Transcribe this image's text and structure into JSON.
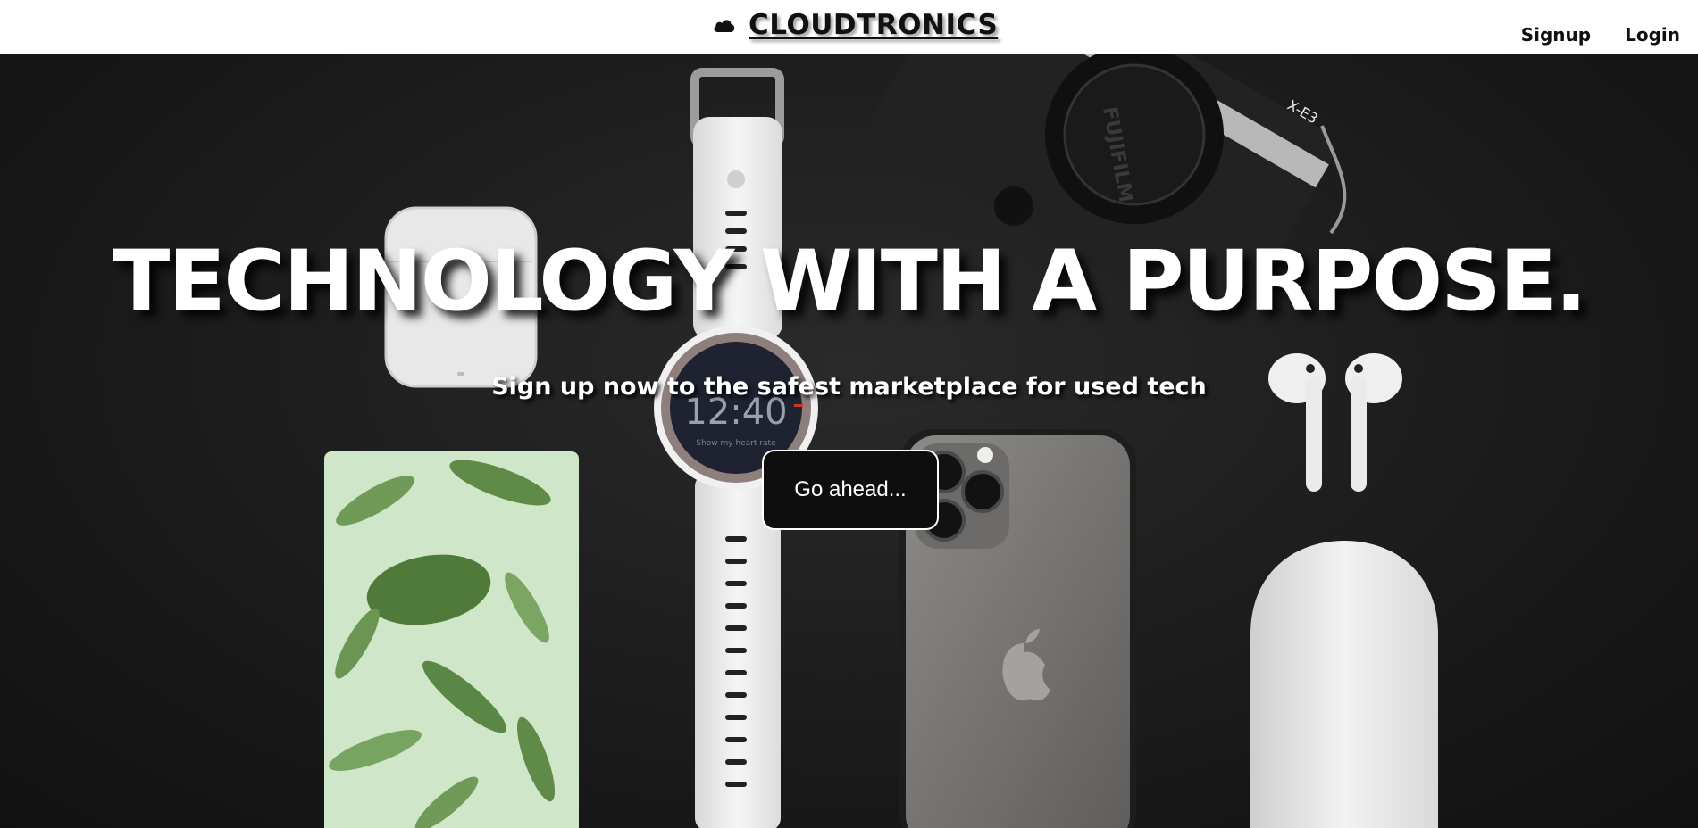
{
  "header": {
    "brand_icon": "cloud-icon",
    "brand_name": "CLOUDTRONICS",
    "nav": [
      {
        "label": "Signup"
      },
      {
        "label": "Login"
      }
    ]
  },
  "hero": {
    "title": "TECHNOLOGY WITH A PURPOSE.",
    "subtitle": "Sign up now to the safest marketplace for used tech",
    "cta_label": "Go ahead...",
    "watch_time": "12:40",
    "watch_caption": "Show my heart rate",
    "camera_model": "X-E3",
    "camera_brand": "FUJIFILM"
  },
  "colors": {
    "background_dark": "#1b1a1a",
    "text_light": "#ffffff",
    "text_dark": "#111111",
    "notebook_green": "#cfe6c8"
  }
}
